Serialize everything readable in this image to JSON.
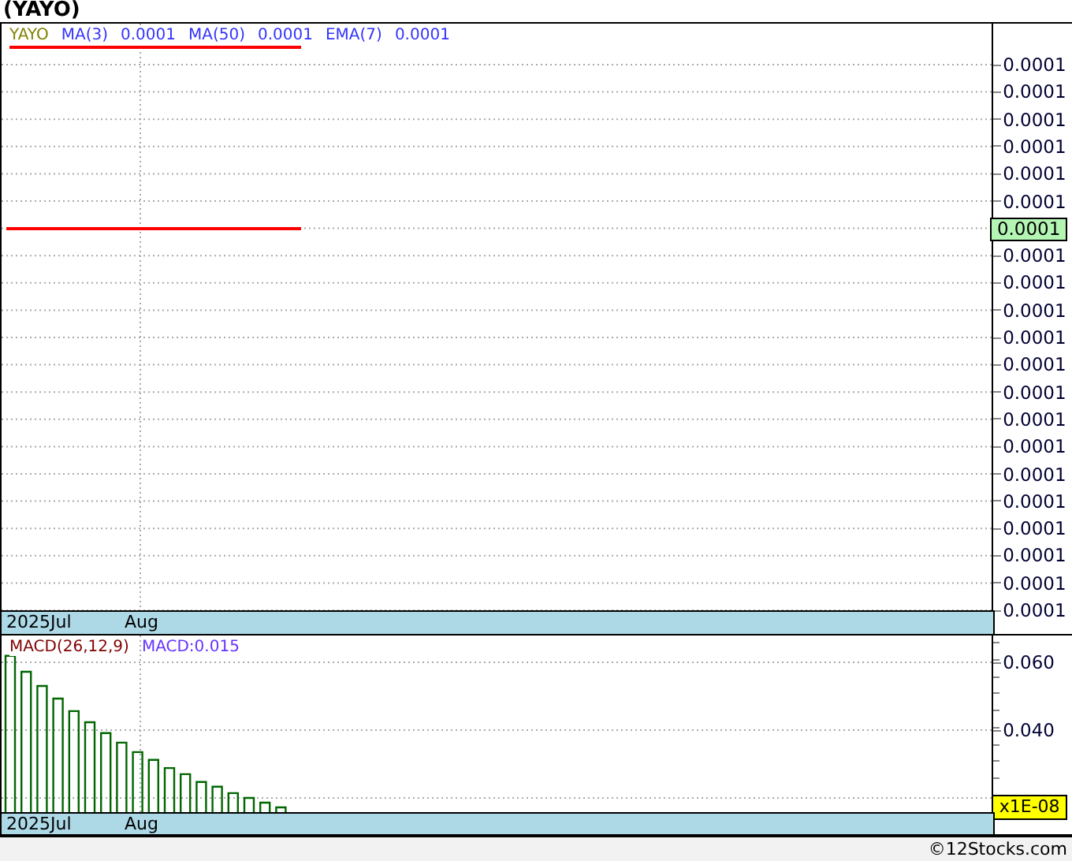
{
  "title": "(YAYO)",
  "price_panel": {
    "legend": [
      {
        "text": "YAYO",
        "color": "#808000"
      },
      {
        "text": "MA(3)",
        "color": "#3333ff"
      },
      {
        "text": "0.0001",
        "color": "#3333ff"
      },
      {
        "text": "MA(50)",
        "color": "#3333ff"
      },
      {
        "text": "0.0001",
        "color": "#3333ff"
      },
      {
        "text": "EMA(7)",
        "color": "#3333ff"
      },
      {
        "text": "0.0001",
        "color": "#3333ff"
      }
    ],
    "y_axis_labels": [
      "0.0001",
      "0.0001",
      "0.0001",
      "0.0001",
      "0.0001",
      "0.0001",
      "0.0001",
      "0.0001",
      "0.0001",
      "0.0001",
      "0.0001",
      "0.0001",
      "0.0001",
      "0.0001",
      "0.0001",
      "0.0001",
      "0.0001",
      "0.0001",
      "0.0001",
      "0.0001"
    ],
    "last_price": "0.0001",
    "date_labels": [
      "2025Jul",
      "Aug"
    ]
  },
  "macd_panel": {
    "legend": [
      {
        "text": "MACD(26,12,9)",
        "color": "#800000"
      },
      {
        "text": "MACD:0.015",
        "color": "#6633ff"
      }
    ],
    "multiplier": "x1E-08",
    "y_axis_labels": [
      "0.060",
      "0.040"
    ],
    "date_labels": [
      "2025Jul",
      "Aug"
    ]
  },
  "footer": "©12Stocks.com"
}
